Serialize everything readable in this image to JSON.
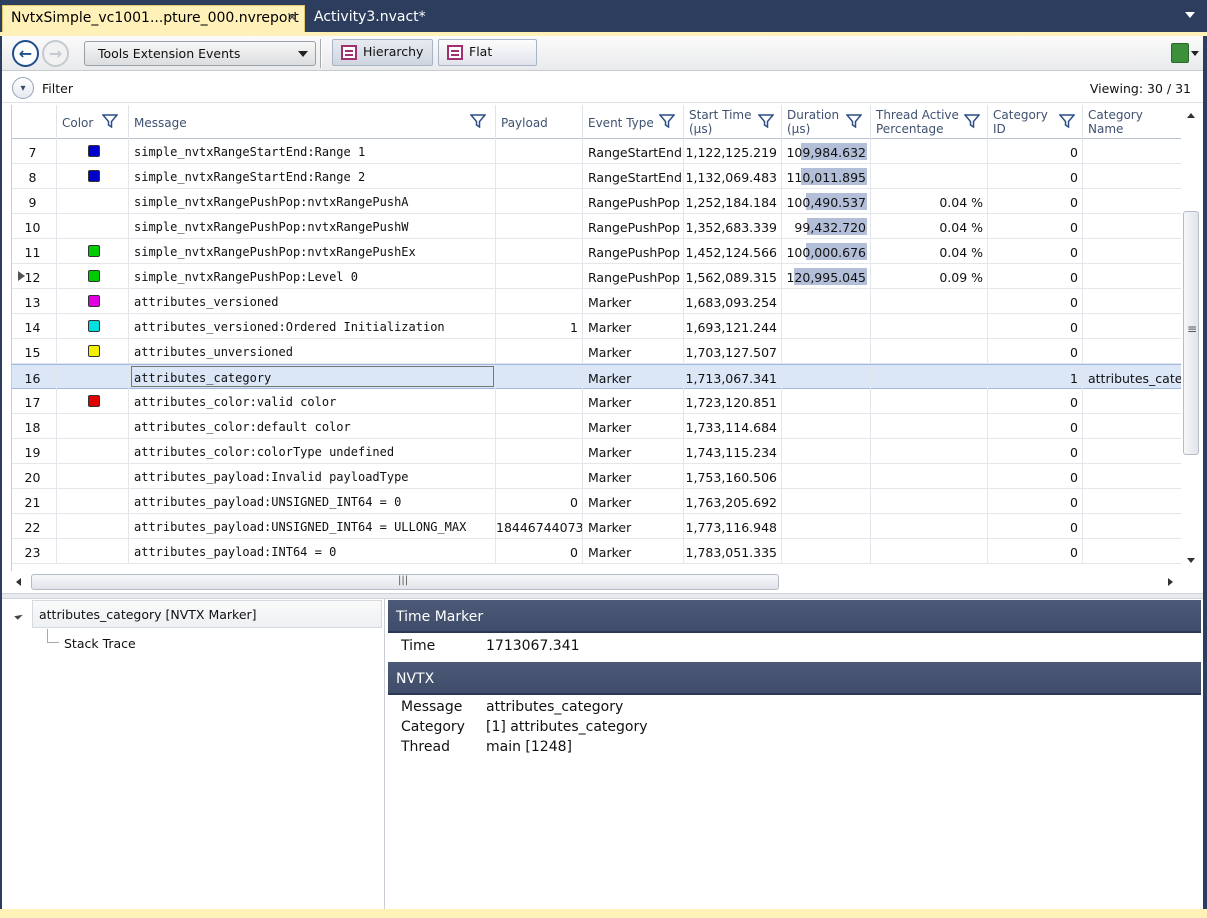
{
  "tabs": [
    {
      "label": "NvtxSimple_vc1001...pture_000.nvreport",
      "active": true
    },
    {
      "label": "Activity3.nvact*",
      "active": false
    }
  ],
  "toolbar": {
    "event_combo": "Tools Extension Events",
    "hierarchy_label": "Hierarchy",
    "flat_label": "Flat"
  },
  "filter": {
    "label": "Filter",
    "viewing": "Viewing: 30 / 31"
  },
  "grid": {
    "columns": {
      "color": "Color",
      "message": "Message",
      "payload": "Payload",
      "event_type": "Event Type",
      "start_time": "Start Time",
      "start_time_unit": "(µs)",
      "duration": "Duration",
      "duration_unit": "(µs)",
      "thread_active": "Thread Active",
      "thread_active_2": "Percentage",
      "category_id": "Category",
      "category_id_2": "ID",
      "category_name": "Category",
      "category_name_2": "Name"
    },
    "rows": [
      {
        "num": "7",
        "color": "#0000cc",
        "message": "simple_nvtxRangeStartEnd:Range 1",
        "payload": "",
        "type": "RangeStartEnd",
        "start": "1,122,125.219",
        "duration": "109,984.632",
        "dur_frac": 0.87,
        "pct": "",
        "cat_id": "0",
        "cat_name": ""
      },
      {
        "num": "8",
        "color": "#0000cc",
        "message": "simple_nvtxRangeStartEnd:Range 2",
        "payload": "",
        "type": "RangeStartEnd",
        "start": "1,132,069.483",
        "duration": "110,011.895",
        "dur_frac": 0.87,
        "pct": "",
        "cat_id": "0",
        "cat_name": ""
      },
      {
        "num": "9",
        "color": "",
        "message": "simple_nvtxRangePushPop:nvtxRangePushA",
        "payload": "",
        "type": "RangePushPop",
        "start": "1,252,184.184",
        "duration": "100,490.537",
        "dur_frac": 0.8,
        "pct": "0.04 %",
        "cat_id": "0",
        "cat_name": ""
      },
      {
        "num": "10",
        "color": "",
        "message": "simple_nvtxRangePushPop:nvtxRangePushW",
        "payload": "",
        "type": "RangePushPop",
        "start": "1,352,683.339",
        "duration": "99,432.720",
        "dur_frac": 0.79,
        "pct": "0.04 %",
        "cat_id": "0",
        "cat_name": ""
      },
      {
        "num": "11",
        "color": "#00cc00",
        "message": "simple_nvtxRangePushPop:nvtxRangePushEx",
        "payload": "",
        "type": "RangePushPop",
        "start": "1,452,124.566",
        "duration": "100,000.676",
        "dur_frac": 0.8,
        "pct": "0.04 %",
        "cat_id": "0",
        "cat_name": ""
      },
      {
        "num": "12",
        "color": "#00cc00",
        "message": "simple_nvtxRangePushPop:Level 0",
        "payload": "",
        "type": "RangePushPop",
        "start": "1,562,089.315",
        "duration": "120,995.045",
        "dur_frac": 0.96,
        "pct": "0.09 %",
        "cat_id": "0",
        "cat_name": "",
        "expandable": true
      },
      {
        "num": "13",
        "color": "#e000e0",
        "message": "attributes_versioned",
        "payload": "",
        "type": "Marker",
        "start": "1,683,093.254",
        "duration": "",
        "dur_frac": 0,
        "pct": "",
        "cat_id": "0",
        "cat_name": ""
      },
      {
        "num": "14",
        "color": "#00e0e0",
        "message": "attributes_versioned:Ordered Initialization",
        "payload": "1",
        "type": "Marker",
        "start": "1,693,121.244",
        "duration": "",
        "dur_frac": 0,
        "pct": "",
        "cat_id": "0",
        "cat_name": ""
      },
      {
        "num": "15",
        "color": "#f0f000",
        "message": "attributes_unversioned",
        "payload": "",
        "type": "Marker",
        "start": "1,703,127.507",
        "duration": "",
        "dur_frac": 0,
        "pct": "",
        "cat_id": "0",
        "cat_name": ""
      },
      {
        "num": "16",
        "color": "",
        "message": "attributes_category",
        "payload": "",
        "type": "Marker",
        "start": "1,713,067.341",
        "duration": "",
        "dur_frac": 0,
        "pct": "",
        "cat_id": "1",
        "cat_name": "attributes_categ",
        "selected": true
      },
      {
        "num": "17",
        "color": "#e00000",
        "message": "attributes_color:valid color",
        "payload": "",
        "type": "Marker",
        "start": "1,723,120.851",
        "duration": "",
        "dur_frac": 0,
        "pct": "",
        "cat_id": "0",
        "cat_name": ""
      },
      {
        "num": "18",
        "color": "",
        "message": "attributes_color:default color",
        "payload": "",
        "type": "Marker",
        "start": "1,733,114.684",
        "duration": "",
        "dur_frac": 0,
        "pct": "",
        "cat_id": "0",
        "cat_name": ""
      },
      {
        "num": "19",
        "color": "",
        "message": "attributes_color:colorType undefined",
        "payload": "",
        "type": "Marker",
        "start": "1,743,115.234",
        "duration": "",
        "dur_frac": 0,
        "pct": "",
        "cat_id": "0",
        "cat_name": ""
      },
      {
        "num": "20",
        "color": "",
        "message": "attributes_payload:Invalid payloadType",
        "payload": "",
        "type": "Marker",
        "start": "1,753,160.506",
        "duration": "",
        "dur_frac": 0,
        "pct": "",
        "cat_id": "0",
        "cat_name": ""
      },
      {
        "num": "21",
        "color": "",
        "message": "attributes_payload:UNSIGNED_INT64 = 0",
        "payload": "0",
        "type": "Marker",
        "start": "1,763,205.692",
        "duration": "",
        "dur_frac": 0,
        "pct": "",
        "cat_id": "0",
        "cat_name": ""
      },
      {
        "num": "22",
        "color": "",
        "message": "attributes_payload:UNSIGNED_INT64 = ULLONG_MAX",
        "payload": "18446744073",
        "type": "Marker",
        "start": "1,773,116.948",
        "duration": "",
        "dur_frac": 0,
        "pct": "",
        "cat_id": "0",
        "cat_name": ""
      },
      {
        "num": "23",
        "color": "",
        "message": "attributes_payload:INT64 = 0",
        "payload": "0",
        "type": "Marker",
        "start": "1,783,051.335",
        "duration": "",
        "dur_frac": 0,
        "pct": "",
        "cat_id": "0",
        "cat_name": ""
      }
    ]
  },
  "tree": {
    "root": "attributes_category [NVTX Marker]",
    "child": "Stack Trace"
  },
  "details": {
    "time_marker_title": "Time Marker",
    "time_label": "Time",
    "time_value": "1713067.341",
    "nvtx_title": "NVTX",
    "message_label": "Message",
    "message_value": "attributes_category",
    "category_label": "Category",
    "category_value": "[1] attributes_category",
    "thread_label": "Thread",
    "thread_value": "main [1248]"
  }
}
